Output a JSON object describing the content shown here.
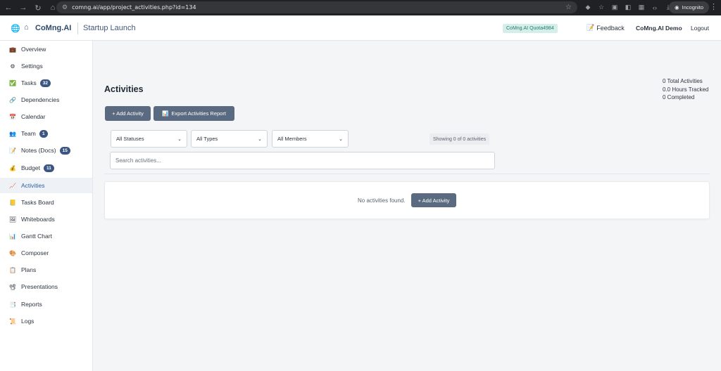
{
  "browser": {
    "url": "comng.ai/app/project_activities.php?id=134",
    "incognito_label": "Incognito"
  },
  "header": {
    "brand": "CoMng.AI",
    "project": "Startup Launch",
    "quota": "CoMng.AI Quota4984",
    "feedback": "Feedback",
    "user": "CoMng.AI Demo",
    "logout": "Logout"
  },
  "sidebar": {
    "items": [
      {
        "label": "Overview",
        "icon": "briefcase-icon",
        "glyph": "💼"
      },
      {
        "label": "Settings",
        "icon": "gear-icon",
        "glyph": "⚙"
      },
      {
        "label": "Tasks",
        "icon": "checkbox-icon",
        "glyph": "✅",
        "badge": "32"
      },
      {
        "label": "Dependencies",
        "icon": "link-icon",
        "glyph": "🔗"
      },
      {
        "label": "Calendar",
        "icon": "calendar-icon",
        "glyph": "📅"
      },
      {
        "label": "Team",
        "icon": "people-icon",
        "glyph": "👥",
        "badge": "1"
      },
      {
        "label": "Notes (Docs)",
        "icon": "notes-icon",
        "glyph": "📝",
        "badge": "15"
      },
      {
        "label": "Budget",
        "icon": "money-bag-icon",
        "glyph": "💰",
        "badge": "11"
      },
      {
        "label": "Activities",
        "icon": "chart-icon",
        "glyph": "📈",
        "active": true
      },
      {
        "label": "Tasks Board",
        "icon": "sticky-note-icon",
        "glyph": "📒"
      },
      {
        "label": "Whiteboards",
        "icon": "picture-icon",
        "glyph": "🖼"
      },
      {
        "label": "Gantt Chart",
        "icon": "bar-chart-icon",
        "glyph": "📊"
      },
      {
        "label": "Composer",
        "icon": "palette-icon",
        "glyph": "🎨"
      },
      {
        "label": "Plans",
        "icon": "clipboard-icon",
        "glyph": "📋"
      },
      {
        "label": "Presentations",
        "icon": "projector-icon",
        "glyph": "📽"
      },
      {
        "label": "Reports",
        "icon": "report-icon",
        "glyph": "📑"
      },
      {
        "label": "Logs",
        "icon": "scroll-icon",
        "glyph": "📜"
      }
    ]
  },
  "main": {
    "title": "Activities",
    "stats": {
      "total": "0 Total Activities",
      "hours": "0.0 Hours Tracked",
      "completed": "0 Completed"
    },
    "add_button": "+ Add Activity",
    "export_button": "Export Activities Report",
    "filters": {
      "status": "All Statuses",
      "type": "All Types",
      "members": "All Members"
    },
    "showing": "Showing 0 of 0 activities",
    "search_placeholder": "Search activities...",
    "empty_text": "No activities found.",
    "empty_add_button": "+ Add Activity"
  }
}
